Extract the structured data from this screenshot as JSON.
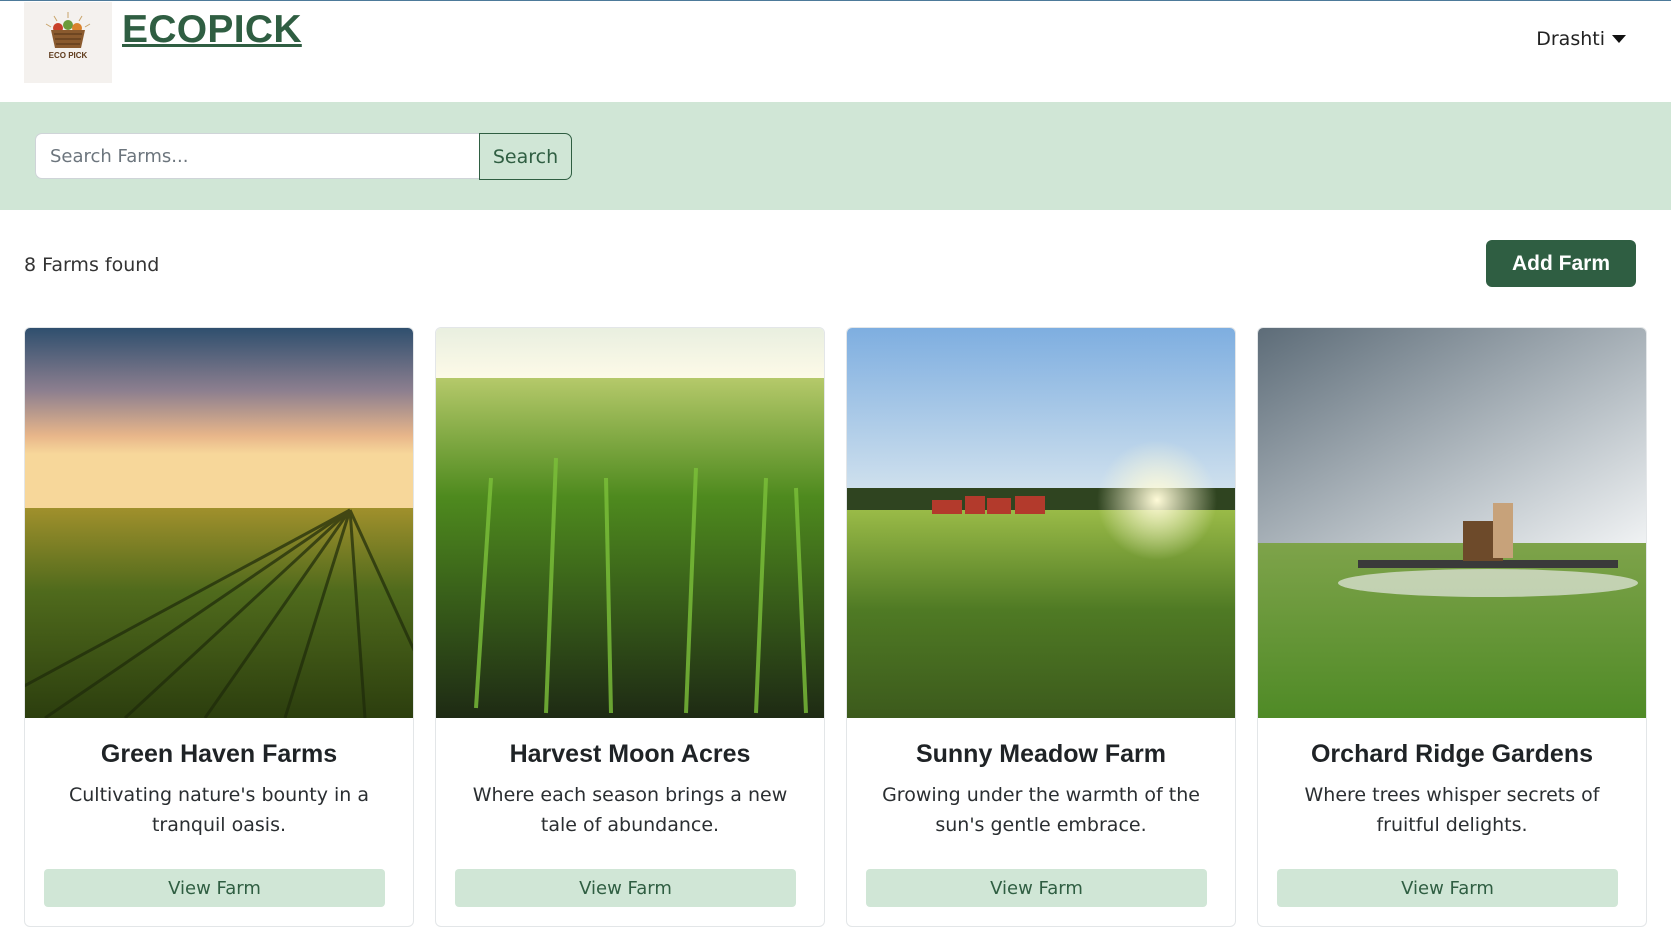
{
  "header": {
    "brand": "ECOPICK",
    "logo_text": "ECO PICK",
    "user_name": "Drashti"
  },
  "search": {
    "placeholder": "Search Farms...",
    "button_label": "Search"
  },
  "results": {
    "count_text": "8 Farms found",
    "add_button_label": "Add Farm"
  },
  "cards": [
    {
      "title": "Green Haven Farms",
      "description": "Cultivating nature's bounty in a tranquil oasis.",
      "button_label": "View Farm"
    },
    {
      "title": "Harvest Moon Acres",
      "description": "Where each season brings a new tale of abundance.",
      "button_label": "View Farm"
    },
    {
      "title": "Sunny Meadow Farm",
      "description": "Growing under the warmth of the sun's gentle embrace.",
      "button_label": "View Farm"
    },
    {
      "title": "Orchard Ridge Gardens",
      "description": "Where trees whisper secrets of fruitful delights.",
      "button_label": "View Farm"
    }
  ],
  "colors": {
    "brand_green": "#2f5e42",
    "band_green": "#d0e6d6"
  },
  "icons": [
    "logo-basket-icon",
    "caret-down-icon"
  ]
}
